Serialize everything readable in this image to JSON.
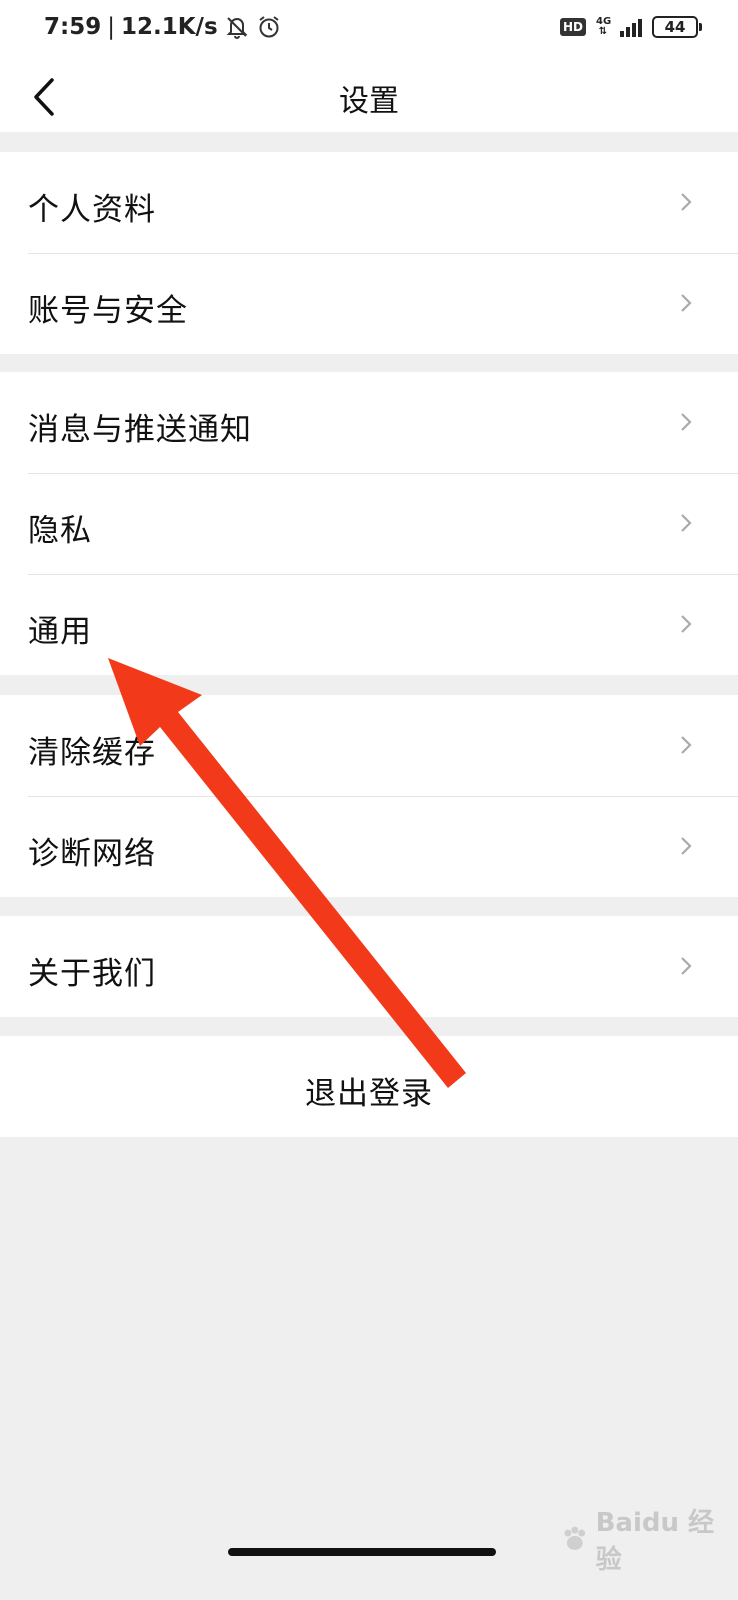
{
  "status_bar": {
    "time": "7:59",
    "speed": "12.1K/s",
    "hd": "HD",
    "network": "4G",
    "battery": "44"
  },
  "header": {
    "title": "设置"
  },
  "groups": [
    {
      "items": [
        {
          "label": "个人资料"
        },
        {
          "label": "账号与安全"
        }
      ]
    },
    {
      "items": [
        {
          "label": "消息与推送通知"
        },
        {
          "label": "隐私"
        },
        {
          "label": "通用"
        }
      ]
    },
    {
      "items": [
        {
          "label": "清除缓存"
        },
        {
          "label": "诊断网络"
        }
      ]
    },
    {
      "items": [
        {
          "label": "关于我们"
        }
      ]
    }
  ],
  "logout_label": "退出登录",
  "watermark": "Baidu 经验",
  "colors": {
    "annotation_arrow": "#f23a1a",
    "background": "#efefef",
    "row_background": "#ffffff"
  }
}
